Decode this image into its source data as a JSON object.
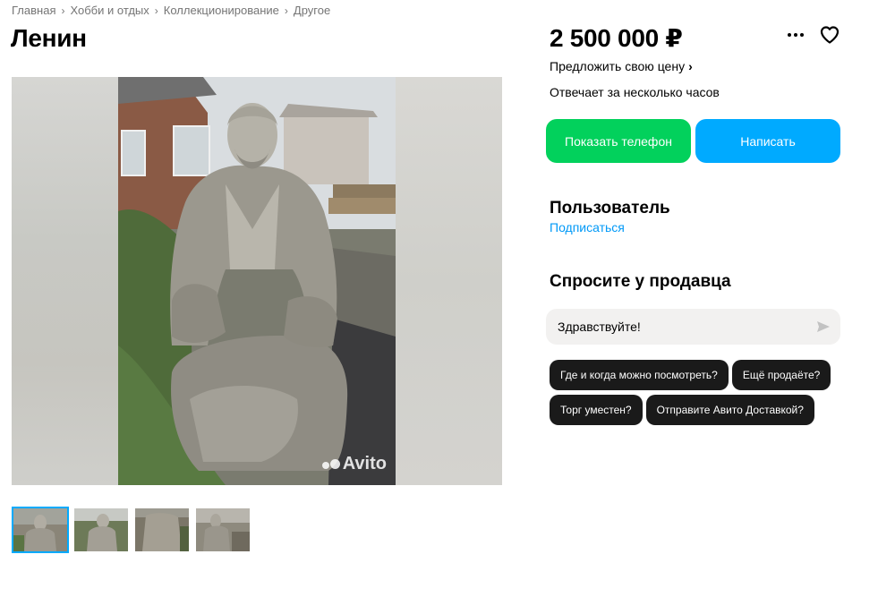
{
  "breadcrumbs": [
    "Главная",
    "Хобби и отдых",
    "Коллекционирование",
    "Другое"
  ],
  "breadcrumb_separator": "›",
  "listing": {
    "title": "Ленин",
    "price": "2 500 000 ₽",
    "offer_price_label": "Предложить свою цену",
    "reply_time": "Отвечает за несколько часов"
  },
  "actions": {
    "phone_button": "Показать телефон",
    "write_button": "Написать"
  },
  "seller": {
    "name": "Пользователь",
    "subscribe_label": "Подписаться"
  },
  "ask": {
    "title": "Спросите у продавца",
    "input_value": "Здравствуйте!",
    "chips": [
      "Где и когда можно посмотреть?",
      "Ещё продаёте?",
      "Торг уместен?",
      "Отправите Авито Доставкой?"
    ]
  },
  "gallery": {
    "watermark": "Avito",
    "thumbnail_count": 4,
    "active_thumbnail": 0
  },
  "icons": {
    "more": "more-dots-icon",
    "favorite": "heart-icon",
    "send": "send-icon"
  },
  "colors": {
    "phone_button": "#02d15c",
    "write_button": "#00aaff",
    "link": "#0099f7",
    "chip_bg": "#1a1a1a"
  }
}
